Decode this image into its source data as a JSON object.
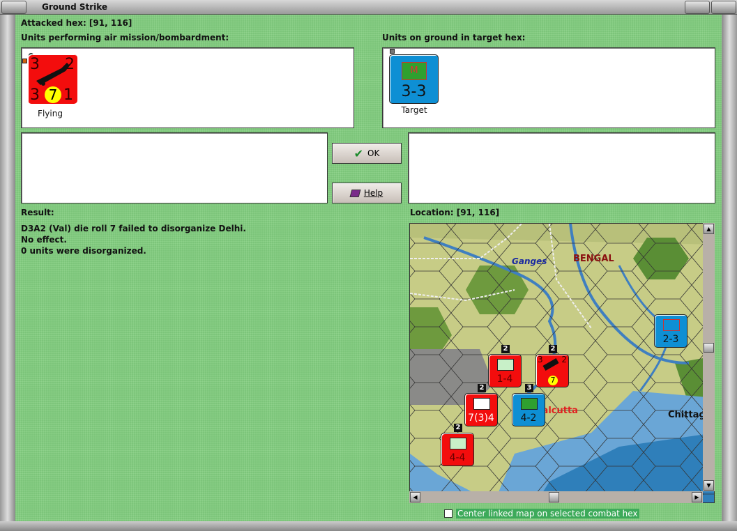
{
  "window": {
    "title": "Ground Strike"
  },
  "attacked_hex": "Attacked hex:  [91, 116]",
  "air_units_label": "Units performing air mission/bombardment:",
  "ground_units_label": "Units on ground in target hex:",
  "air_units": [
    {
      "attack": "3",
      "defense": "2",
      "range": "3",
      "roll": "7",
      "move": "1",
      "status": "Flying"
    }
  ],
  "ground_units": [
    {
      "symbol": "M",
      "strength": "3-3",
      "status": "Target"
    }
  ],
  "buttons": {
    "ok": "OK",
    "help": "Help"
  },
  "result": {
    "label": "Result:",
    "lines": [
      "D3A2 (Val) die roll 7 failed to disorganize Delhi.",
      "No effect.",
      "0 units were disorganized."
    ]
  },
  "location": {
    "label": "Location:   [91, 116]"
  },
  "map": {
    "labels": {
      "river": "Ganges",
      "region": "BENGAL",
      "city1": "Calcutta",
      "city2": "Chittag"
    },
    "units": [
      {
        "type": "naval",
        "strength": "1-4",
        "stack": "2",
        "color": "red"
      },
      {
        "type": "air",
        "strength": "3 7 1",
        "stack": "2",
        "color": "red",
        "attack": "3",
        "defense": "2",
        "roll": "7"
      },
      {
        "type": "infantry",
        "strength": "7(3)4",
        "stack": "2",
        "color": "red"
      },
      {
        "type": "T",
        "strength": "4-2",
        "stack": "3",
        "color": "blue"
      },
      {
        "type": "naval",
        "strength": "4-4",
        "stack": "2",
        "color": "red"
      },
      {
        "type": "M",
        "strength": "2-3",
        "stack": "",
        "color": "blue"
      }
    ]
  },
  "checkbox": {
    "label": "Center linked map on selected combat hex",
    "checked": false
  },
  "colors": {
    "bg": "#7cc57a",
    "axis_red": "#f30d0d",
    "allied_blue": "#0e8fd4"
  }
}
